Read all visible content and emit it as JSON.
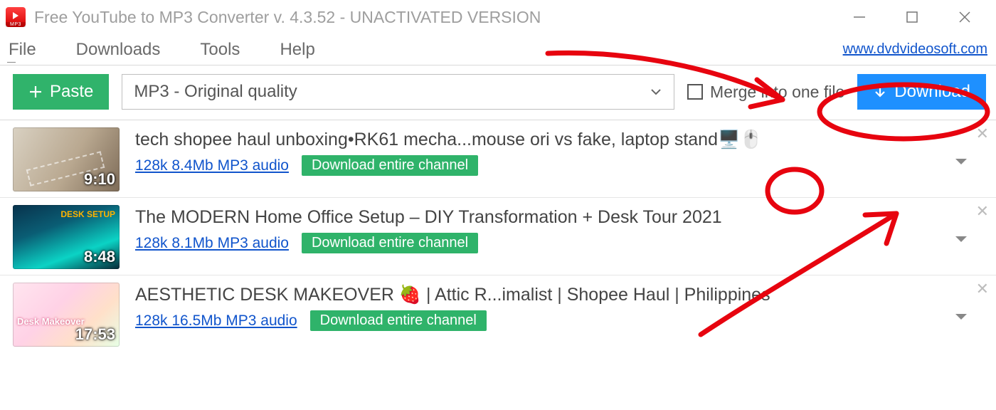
{
  "window": {
    "title": "Free YouTube to MP3 Converter v. 4.3.52 - UNACTIVATED VERSION"
  },
  "menu": {
    "items": [
      "File",
      "Downloads",
      "Tools",
      "Help"
    ],
    "site_link": "www.dvdvideosoft.com"
  },
  "toolbar": {
    "paste_label": "Paste",
    "quality_selected": "MP3 - Original quality",
    "merge_label": "Merge into one file",
    "download_label": "Download"
  },
  "list": [
    {
      "title": "tech shopee haul unboxing•RK61 mecha...mouse ori vs fake, laptop stand🖥️🖱️",
      "duration": "9:10",
      "info": "128k 8.4Mb MP3 audio ",
      "badge": "Download entire channel"
    },
    {
      "title": "The MODERN Home Office Setup – DIY Transformation + Desk Tour 2021",
      "duration": "8:48",
      "info": "128k 8.1Mb MP3 audio ",
      "badge": "Download entire channel"
    },
    {
      "title": "AESTHETIC DESK MAKEOVER 🍓 | Attic R...imalist | Shopee Haul | Philippines",
      "duration": "17:53",
      "info": "128k 16.5Mb MP3 audio ",
      "badge": "Download entire channel"
    }
  ],
  "annotation": {
    "stroke": "#e7040f"
  }
}
